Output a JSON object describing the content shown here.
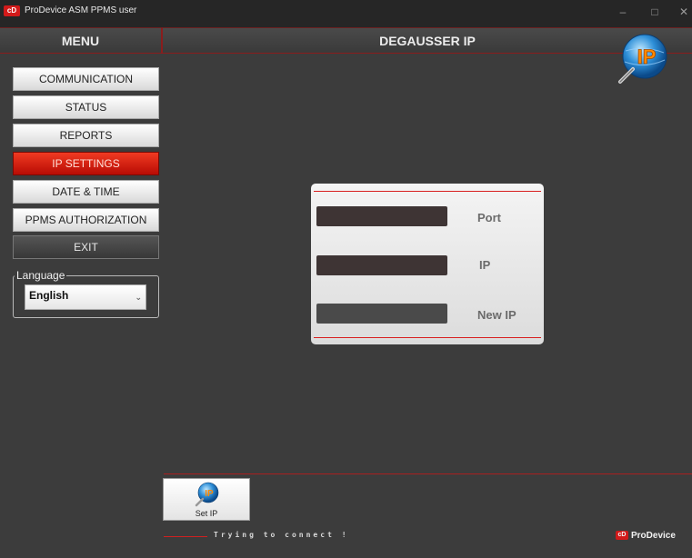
{
  "window": {
    "title": "ProDevice ASM PPMS user",
    "logo_text": "cD",
    "minimize": "–",
    "maximize": "□",
    "close": "✕"
  },
  "header": {
    "menu_title": "MENU",
    "page_title": "DEGAUSSER IP",
    "badge_text": "IP"
  },
  "menu": {
    "communication": "COMMUNICATION",
    "status": "STATUS",
    "reports": "REPORTS",
    "ip_settings": "IP SETTINGS",
    "date_time": "DATE & TIME",
    "ppms_authorization": "PPMS AUTHORIZATION",
    "exit": "EXIT",
    "active_item": "IP SETTINGS"
  },
  "language": {
    "legend": "Language",
    "selected": "English"
  },
  "ip_panel": {
    "port_label": "Port",
    "port_value": "",
    "ip_label": "IP",
    "ip_value": "",
    "new_ip_label": "New IP",
    "new_ip_value": ""
  },
  "toolbar": {
    "set_ip_label": "Set IP"
  },
  "status": {
    "message": "Trying to connect !"
  },
  "brand": {
    "logo_text": "cD",
    "name": "ProDevice"
  },
  "colors": {
    "accent": "#d21a1a",
    "background": "#3c3c3c",
    "active_menu": "#e02a16"
  }
}
